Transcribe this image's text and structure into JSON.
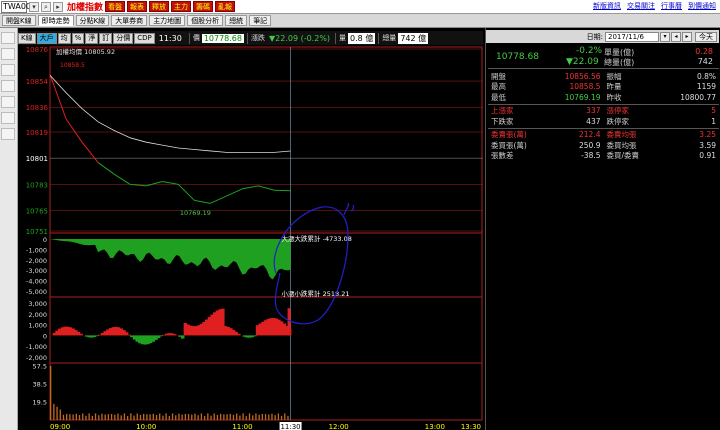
{
  "topbar": {
    "symbol": "TWA00",
    "title": "加權指數",
    "red_buttons": [
      "看盤",
      "報表",
      "釋放",
      "主力",
      "籌碼",
      "亂報"
    ],
    "links": [
      "新版資訊",
      "交易關注",
      "行事曆",
      "到價通知"
    ]
  },
  "tabs": [
    "開盤K線",
    "即時走勢",
    "分點K線",
    "大單券商",
    "主力地圖",
    "個股分析",
    "總統",
    "筆記"
  ],
  "active_tab": "即時走勢",
  "toolbar": {
    "buttons": [
      "K線",
      "大戶",
      "均",
      "%",
      "淨",
      "訂",
      "分價",
      "CDP"
    ],
    "active_buttons": [
      "大戶"
    ],
    "time": "11:30",
    "price_label": "價",
    "price": "10778.68",
    "change_label": "漲跌",
    "change": "▼22.09 (-0.2%)",
    "volume_label": "量",
    "volume": "0.8 億",
    "total_label": "總量",
    "total": "742 億"
  },
  "chart": {
    "legend_avg": "加權均價 10805.92",
    "open_label": "10858.5",
    "low_label": "10769.19",
    "price_ticks": [
      "10876",
      "10854",
      "10836",
      "10819",
      "10801",
      "10783",
      "10765",
      "10751"
    ],
    "flow1_label": "大漲大跌累計 -4733.08",
    "flow1_ticks": [
      "0",
      "-1,000",
      "-2,000",
      "-3,000",
      "-4,000",
      "-5,000"
    ],
    "flow2_label": "小漲小跌累計 2518.21",
    "flow2_ticks": [
      "3,000",
      "2,000",
      "1,000",
      "0",
      "-1,000",
      "-2,000"
    ],
    "vol_ticks": [
      "57.5",
      "38.5",
      "19.5"
    ],
    "time_labels": [
      "09:00",
      "10:00",
      "11:00",
      "11:30",
      "12:00",
      "13:00",
      "13:30"
    ],
    "colors": {
      "up": "#e02020",
      "down": "#20a020",
      "avg": "#dddddd",
      "grid": "#aa2020",
      "scribble": "#2020d0"
    }
  },
  "chart_data": {
    "type": "line",
    "title": "加權指數",
    "x": [
      "09:00",
      "09:10",
      "09:20",
      "09:30",
      "09:40",
      "09:50",
      "10:00",
      "10:10",
      "10:20",
      "10:30",
      "10:40",
      "10:50",
      "11:00",
      "11:10",
      "11:20",
      "11:30"
    ],
    "series": [
      {
        "name": "價",
        "values": [
          10858.5,
          10828,
          10812,
          10798,
          10790,
          10783,
          10782,
          10785,
          10783,
          10772,
          10770,
          10775,
          10780,
          10782,
          10779,
          10778.68
        ]
      },
      {
        "name": "加權均價",
        "values": [
          10858,
          10846,
          10835,
          10826,
          10820,
          10815,
          10812,
          10810,
          10808,
          10807,
          10806,
          10805,
          10805,
          10805,
          10805,
          10805.92
        ]
      }
    ],
    "ylim": [
      10751,
      10876
    ],
    "reference": 10801,
    "flow_big_final": -4733.08,
    "flow_small_final": 2518.21
  },
  "right": {
    "date_label": "日期:",
    "date": "2017/11/6",
    "today": "今天",
    "price": "10778.68",
    "pct": "-0.2%",
    "change": "▼22.09",
    "unit_vol_label": "單量(億)",
    "unit_vol": "0.28",
    "total_vol_label": "總量(億)",
    "total_vol": "742",
    "rows": [
      [
        "開盤",
        "10856.56",
        "振幅",
        "0.8%"
      ],
      [
        "最高",
        "10858.5",
        "昨量",
        "1159"
      ],
      [
        "最低",
        "10769.19",
        "昨收",
        "10800.77"
      ],
      [
        "上漲家",
        "337",
        "漲停家",
        "5"
      ],
      [
        "下跌家",
        "437",
        "跌停家",
        "1"
      ],
      [
        "委賣張(萬)",
        "212.4",
        "委賣均張",
        "3.25"
      ],
      [
        "委買張(萬)",
        "250.9",
        "委買均張",
        "3.59"
      ],
      [
        "張數差",
        "-38.5",
        "委買/委賣",
        "0.91"
      ]
    ],
    "row_colors": [
      [
        "#ccc",
        "#e33",
        "#ccc",
        "#ddd"
      ],
      [
        "#ccc",
        "#e33",
        "#ccc",
        "#ddd"
      ],
      [
        "#ccc",
        "#4c4",
        "#ccc",
        "#ddd"
      ],
      [
        "#e33",
        "#e33",
        "#e33",
        "#e33"
      ],
      [
        "#ccc",
        "#ddd",
        "#ccc",
        "#ddd"
      ],
      [
        "#e33",
        "#e33",
        "#e33",
        "#e33"
      ],
      [
        "#ccc",
        "#ddd",
        "#ccc",
        "#ddd"
      ],
      [
        "#ccc",
        "#ddd",
        "#ccc",
        "#ddd"
      ]
    ]
  }
}
